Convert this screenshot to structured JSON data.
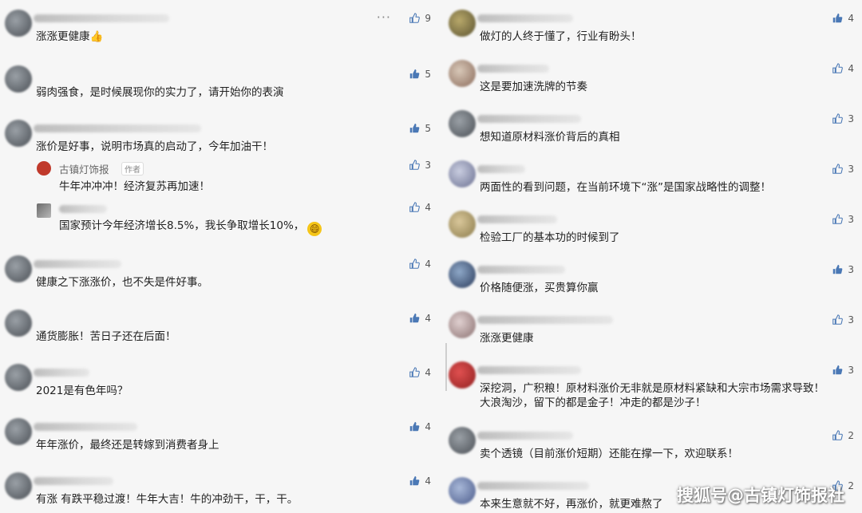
{
  "left": [
    {
      "text": "涨涨更健康👍",
      "likes": "9",
      "liked": false,
      "more": "···"
    },
    {
      "text": "弱肉强食，是时候展现你的实力了，请开始你的表演",
      "likes": "5",
      "liked": true
    },
    {
      "text": "涨价是好事，说明市场真的启动了，今年加油干！",
      "likes": "5",
      "liked": true,
      "replies": [
        {
          "author": "古镇灯饰报",
          "tag": "作者",
          "text": "牛年冲冲冲！经济复苏再加速！",
          "likes": "3"
        },
        {
          "text": "国家预计今年经济增长8.5%，我长争取增长10%，",
          "emoji": "😄",
          "likes": "4"
        }
      ]
    },
    {
      "text": "健康之下涨涨价，也不失是件好事。",
      "likes": "4",
      "liked": false
    },
    {
      "text": "通货膨胀！苦日子还在后面！",
      "likes": "4",
      "liked": true
    },
    {
      "text": "2021是有色年吗？",
      "likes": "4",
      "liked": false
    },
    {
      "text": "年年涨价，最终还是转嫁到消费者身上",
      "likes": "4",
      "liked": true
    },
    {
      "text": "有涨 有跌平稳过渡！牛年大吉！牛的冲劲干，干，干。",
      "likes": "4",
      "liked": true
    }
  ],
  "right": [
    {
      "text": "做灯的人终于懂了，行业有盼头！",
      "likes": "4",
      "liked": true
    },
    {
      "text": "这是要加速洗牌的节奏",
      "likes": "4",
      "liked": false
    },
    {
      "text": "想知道原材料涨价背后的真相",
      "likes": "3",
      "liked": false
    },
    {
      "text": "两面性的看到问题，在当前环境下“涨”是国家战略性的调整！",
      "likes": "3",
      "liked": false
    },
    {
      "text": "检验工厂的基本功的时候到了",
      "likes": "3",
      "liked": false
    },
    {
      "text": "价格随便涨，买贵算你赢",
      "likes": "3",
      "liked": true
    },
    {
      "text": "涨涨更健康",
      "likes": "3",
      "liked": false
    },
    {
      "text": "深挖洞，广积粮！原材料涨价无非就是原材料紧缺和大宗市场需求导致！",
      "text2": "大浪淘沙，留下的都是金子！冲走的都是沙子！",
      "likes": "3",
      "liked": true
    },
    {
      "text": "卖个透镜（目前涨价短期）还能在撑一下，欢迎联系！",
      "likes": "2",
      "liked": false
    },
    {
      "text": "本来生意就不好，再涨价，就更难熬了",
      "likes": "2",
      "liked": false
    }
  ],
  "watermark": "搜狐号@古镇灯饰报社"
}
